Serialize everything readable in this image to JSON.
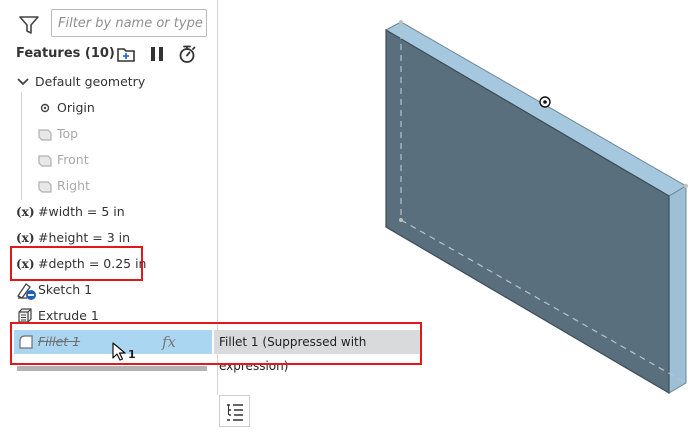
{
  "filter": {
    "placeholder": "Filter by name or type"
  },
  "features": {
    "title": "Features (10)"
  },
  "tree": {
    "default_geometry": "Default geometry",
    "origin": "Origin",
    "top": "Top",
    "front": "Front",
    "right": "Right",
    "width": "#width = 5 in",
    "height": "#height = 3 in",
    "depth": "#depth = 0.25 in",
    "sketch": "Sketch 1",
    "extrude": "Extrude 1",
    "fillet": "Fillet 1"
  },
  "tooltip": {
    "text": "Fillet 1 (Suppressed with expression)"
  },
  "cursor": {
    "badge": "1"
  },
  "icons": {
    "variable": "(x)",
    "fx": "fx"
  },
  "colors": {
    "highlight": "#abd6f2",
    "callout": "#e01a1a",
    "part_face": "#596f7e",
    "part_edge": "#a6c8de"
  }
}
